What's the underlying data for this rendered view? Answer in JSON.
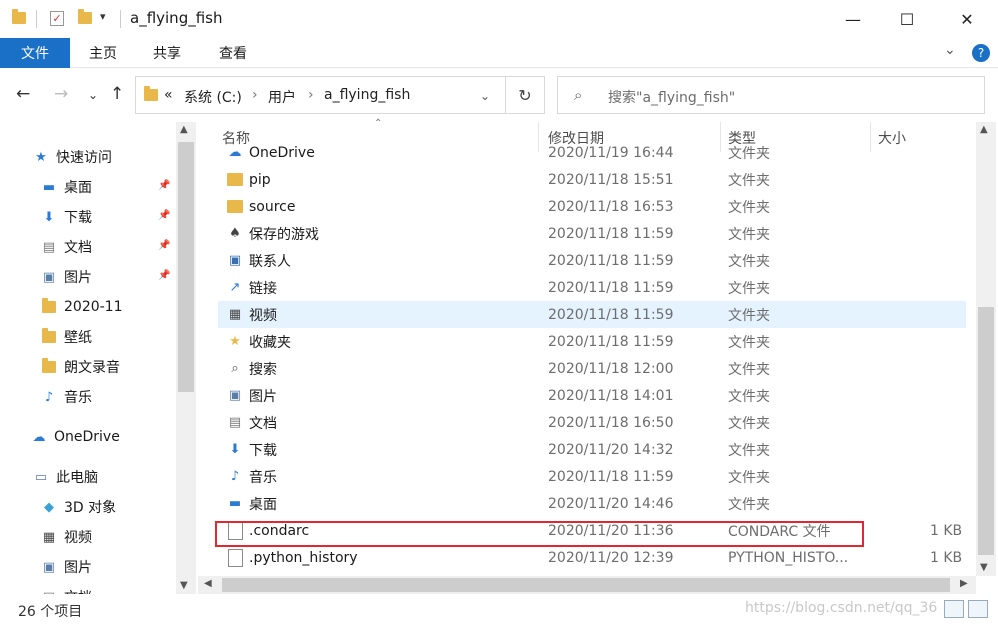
{
  "window": {
    "title": "a_flying_fish",
    "minimize": "—",
    "maximize": "☐",
    "close": "✕"
  },
  "ribbon": {
    "tabs": [
      "文件",
      "主页",
      "共享",
      "查看"
    ],
    "expand": "⌄",
    "help": "?"
  },
  "address": {
    "chevrons": "«",
    "crumbs": [
      "系统 (C:)",
      "用户",
      "a_flying_fish"
    ],
    "search_placeholder": "搜索\"a_flying_fish\""
  },
  "nav_pane": {
    "items": [
      {
        "label": "快速访问",
        "icon": "star-icon",
        "pinned": false
      },
      {
        "label": "桌面",
        "icon": "desktop-icon",
        "pinned": true
      },
      {
        "label": "下载",
        "icon": "download-icon",
        "pinned": true
      },
      {
        "label": "文档",
        "icon": "document-icon",
        "pinned": true
      },
      {
        "label": "图片",
        "icon": "pictures-icon",
        "pinned": true
      },
      {
        "label": "2020-11",
        "icon": "folder-icon",
        "pinned": false
      },
      {
        "label": "壁纸",
        "icon": "folder-icon",
        "pinned": false
      },
      {
        "label": "朗文录音",
        "icon": "folder-icon",
        "pinned": false
      },
      {
        "label": "音乐",
        "icon": "music-icon",
        "pinned": false
      },
      {
        "label": "OneDrive",
        "icon": "cloud-icon",
        "pinned": false
      },
      {
        "label": "此电脑",
        "icon": "computer-icon",
        "pinned": false
      },
      {
        "label": "3D 对象",
        "icon": "cube-icon",
        "pinned": false
      },
      {
        "label": "视频",
        "icon": "video-icon",
        "pinned": false
      },
      {
        "label": "图片",
        "icon": "pictures-icon",
        "pinned": false
      },
      {
        "label": "文档",
        "icon": "document-icon",
        "pinned": false
      }
    ]
  },
  "columns": {
    "name": "名称",
    "date": "修改日期",
    "type": "类型",
    "size": "大小"
  },
  "files": [
    {
      "name": "OneDrive",
      "date": "2020/11/19 16:44",
      "type": "文件夹",
      "size": "",
      "icon": "cloud-icon"
    },
    {
      "name": "pip",
      "date": "2020/11/18 15:51",
      "type": "文件夹",
      "size": "",
      "icon": "folder-icon"
    },
    {
      "name": "source",
      "date": "2020/11/18 16:53",
      "type": "文件夹",
      "size": "",
      "icon": "folder-icon"
    },
    {
      "name": "保存的游戏",
      "date": "2020/11/18 11:59",
      "type": "文件夹",
      "size": "",
      "icon": "games-folder-icon"
    },
    {
      "name": "联系人",
      "date": "2020/11/18 11:59",
      "type": "文件夹",
      "size": "",
      "icon": "contacts-folder-icon"
    },
    {
      "name": "链接",
      "date": "2020/11/18 11:59",
      "type": "文件夹",
      "size": "",
      "icon": "links-folder-icon"
    },
    {
      "name": "视频",
      "date": "2020/11/18 11:59",
      "type": "文件夹",
      "size": "",
      "icon": "video-icon"
    },
    {
      "name": "收藏夹",
      "date": "2020/11/18 11:59",
      "type": "文件夹",
      "size": "",
      "icon": "favorites-folder-icon"
    },
    {
      "name": "搜索",
      "date": "2020/11/18 12:00",
      "type": "文件夹",
      "size": "",
      "icon": "search-folder-icon"
    },
    {
      "name": "图片",
      "date": "2020/11/18 14:01",
      "type": "文件夹",
      "size": "",
      "icon": "pictures-icon"
    },
    {
      "name": "文档",
      "date": "2020/11/18 16:50",
      "type": "文件夹",
      "size": "",
      "icon": "document-icon"
    },
    {
      "name": "下载",
      "date": "2020/11/20 14:32",
      "type": "文件夹",
      "size": "",
      "icon": "download-icon"
    },
    {
      "name": "音乐",
      "date": "2020/11/18 11:59",
      "type": "文件夹",
      "size": "",
      "icon": "music-icon"
    },
    {
      "name": "桌面",
      "date": "2020/11/20 14:46",
      "type": "文件夹",
      "size": "",
      "icon": "desktop-icon"
    },
    {
      "name": ".condarc",
      "date": "2020/11/20 11:36",
      "type": "CONDARC 文件",
      "size": "1 KB",
      "icon": "file-icon"
    },
    {
      "name": ".python_history",
      "date": "2020/11/20 12:39",
      "type": "PYTHON_HISTO...",
      "size": "1 KB",
      "icon": "file-icon"
    }
  ],
  "selected_file": "视频",
  "highlighted_file": ".condarc",
  "status": {
    "count": "26 个项目",
    "watermark": "https://blog.csdn.net/qq_36"
  },
  "colors": {
    "accent": "#1a6fc7",
    "selection": "#e5f3ff",
    "highlight_box": "#e0282e",
    "folder": "#e8b84a"
  }
}
